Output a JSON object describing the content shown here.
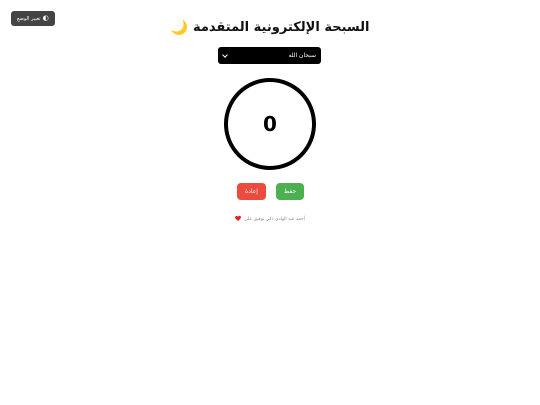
{
  "toolbar": {
    "theme_toggle_label": "تغيير الوضع",
    "theme_toggle_icon": "moon-half-icon"
  },
  "header": {
    "title": "السبحة الإلكترونية المتقدمة",
    "title_icon": "🌙"
  },
  "dhikr_select": {
    "selected": "سبحان الله"
  },
  "counter": {
    "value": "0"
  },
  "actions": {
    "save_label": "حفظ",
    "reset_label": "إعادة"
  },
  "footer": {
    "text": "أحمد عبد الهادي ذكي توفيق علي",
    "icon": "heart-icon"
  },
  "colors": {
    "save": "#4caf50",
    "reset": "#ec4a3c",
    "toggle": "#444444",
    "heart": "#e02424"
  }
}
